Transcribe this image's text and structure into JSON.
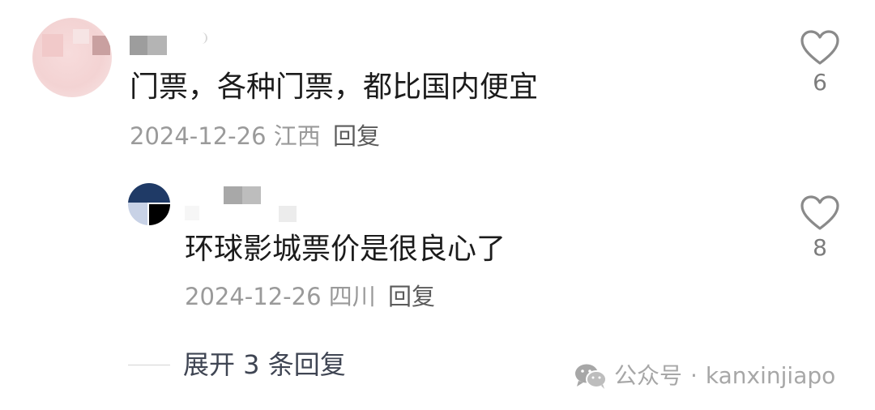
{
  "comment": {
    "text": "门票，各种门票，都比国内便宜",
    "date": "2024-12-26",
    "location": "江西",
    "reply_label": "回复",
    "likes": "6"
  },
  "reply": {
    "text": "环球影城票价是很良心了",
    "date": "2024-12-26",
    "location": "四川",
    "reply_label": "回复",
    "likes": "8"
  },
  "expand_label": "展开 3 条回复",
  "watermark": {
    "prefix": "公众号",
    "separator": "·",
    "account": "kanxinjiapo"
  },
  "colors": {
    "text_primary": "#1b1b1b",
    "text_meta": "#9a9a9a",
    "text_reply": "#5b5b5b",
    "watermark": "#a7a7a7"
  },
  "icons": {
    "like": "heart-outline-icon",
    "watermark": "wechat-icon"
  }
}
